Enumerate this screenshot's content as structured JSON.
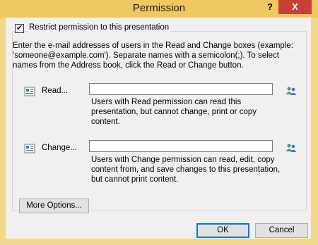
{
  "window": {
    "title": "Permission",
    "help_glyph": "?",
    "close_glyph": "X"
  },
  "restrict": {
    "checked": true,
    "mark": "✔",
    "label": "Restrict permission to this presentation"
  },
  "instructions": "Enter the e-mail addresses of users in the Read and Change boxes (example: 'someone@example.com'). Separate names with a semicolon(;). To select names from the Address book, click the Read or Change button.",
  "read": {
    "button_label": "Read...",
    "value": "",
    "description": "Users with Read permission can read this presentation, but cannot change, print or copy content."
  },
  "change": {
    "button_label": "Change...",
    "value": "",
    "description": "Users with Change permission can read, edit, copy content from, and save changes to this presentation, but cannot print content."
  },
  "buttons": {
    "more_options": "More Options...",
    "ok": "OK",
    "cancel": "Cancel"
  },
  "colors": {
    "title_bar": "#f0c861",
    "close": "#c74033",
    "people_icon": "#4a9a72"
  }
}
